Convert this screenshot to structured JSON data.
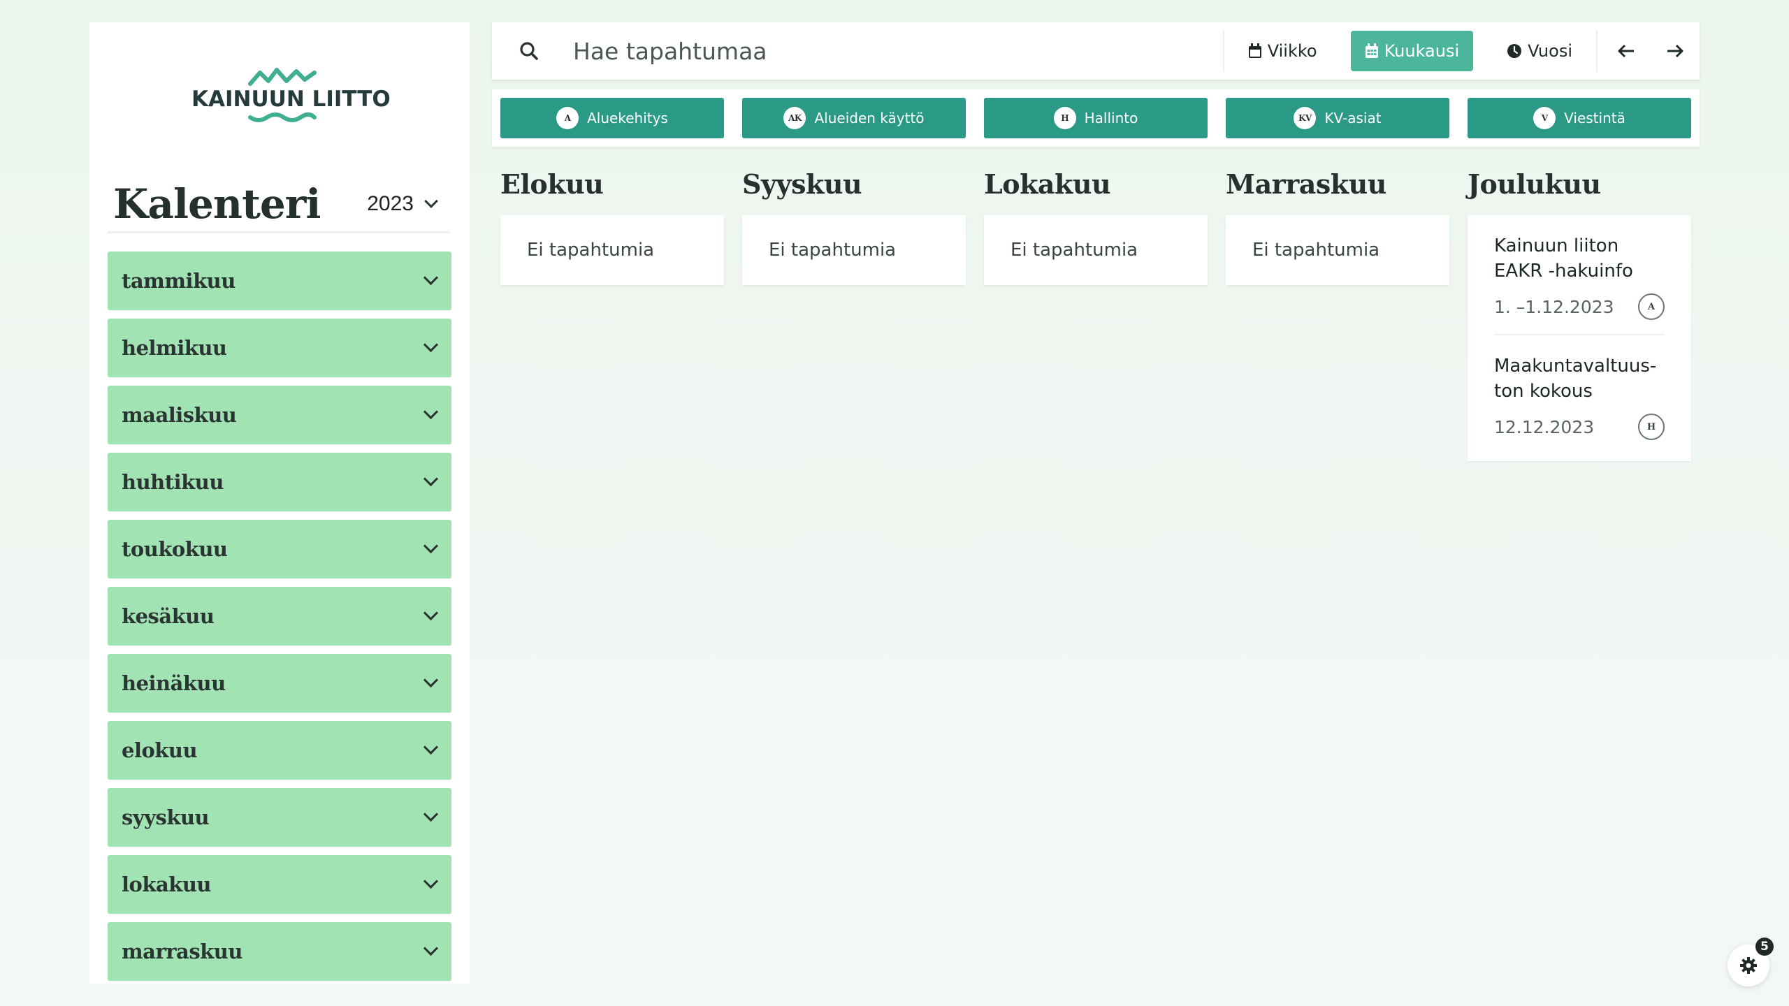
{
  "brand": {
    "logo_text": "KAINUUN LIITTO",
    "accent": "#2a9a86",
    "month_bg": "#a2e3b3",
    "active_view": "#4cb69d"
  },
  "sidebar": {
    "title": "Kalenteri",
    "year": "2023",
    "months": [
      {
        "label": "tammikuu"
      },
      {
        "label": "helmikuu"
      },
      {
        "label": "maaliskuu"
      },
      {
        "label": "huhtikuu"
      },
      {
        "label": "toukokuu"
      },
      {
        "label": "kesäkuu"
      },
      {
        "label": "heinäkuu"
      },
      {
        "label": "elokuu"
      },
      {
        "label": "syyskuu"
      },
      {
        "label": "lokakuu"
      },
      {
        "label": "marraskuu"
      }
    ]
  },
  "search": {
    "placeholder": "Hae tapahtumaa",
    "icon": "search-icon"
  },
  "views": [
    {
      "label": "Viikko",
      "icon": "calendar-icon",
      "active": false
    },
    {
      "label": "Kuukausi",
      "icon": "calendar-grid-icon",
      "active": true
    },
    {
      "label": "Vuosi",
      "icon": "clock-icon",
      "active": false
    }
  ],
  "nav": {
    "prev_icon": "arrow-left-icon",
    "next_icon": "arrow-right-icon"
  },
  "categories": [
    {
      "abbr": "A",
      "label": "Aluekehitys"
    },
    {
      "abbr": "AK",
      "label": "Alueiden käyttö"
    },
    {
      "abbr": "H",
      "label": "Hallinto"
    },
    {
      "abbr": "KV",
      "label": "KV-asiat"
    },
    {
      "abbr": "V",
      "label": "Viestintä"
    }
  ],
  "calendar": {
    "empty_text": "Ei tapahtumia",
    "months": [
      {
        "name": "Elokuu",
        "events": []
      },
      {
        "name": "Syyskuu",
        "events": []
      },
      {
        "name": "Lokakuu",
        "events": []
      },
      {
        "name": "Marraskuu",
        "events": []
      },
      {
        "name": "Joulukuu",
        "events": [
          {
            "title_line1": "Kainuun liiton",
            "title_line2": "EAKR -hakuinfo",
            "date": "1. –1.12.2023",
            "category": "A"
          },
          {
            "title_line1": "Maakuntavaltuus-",
            "title_line2": "ton kokous",
            "date": "12.12.2023",
            "category": "H"
          }
        ]
      }
    ]
  },
  "settings": {
    "icon": "gear-icon",
    "badge_count": "5"
  }
}
